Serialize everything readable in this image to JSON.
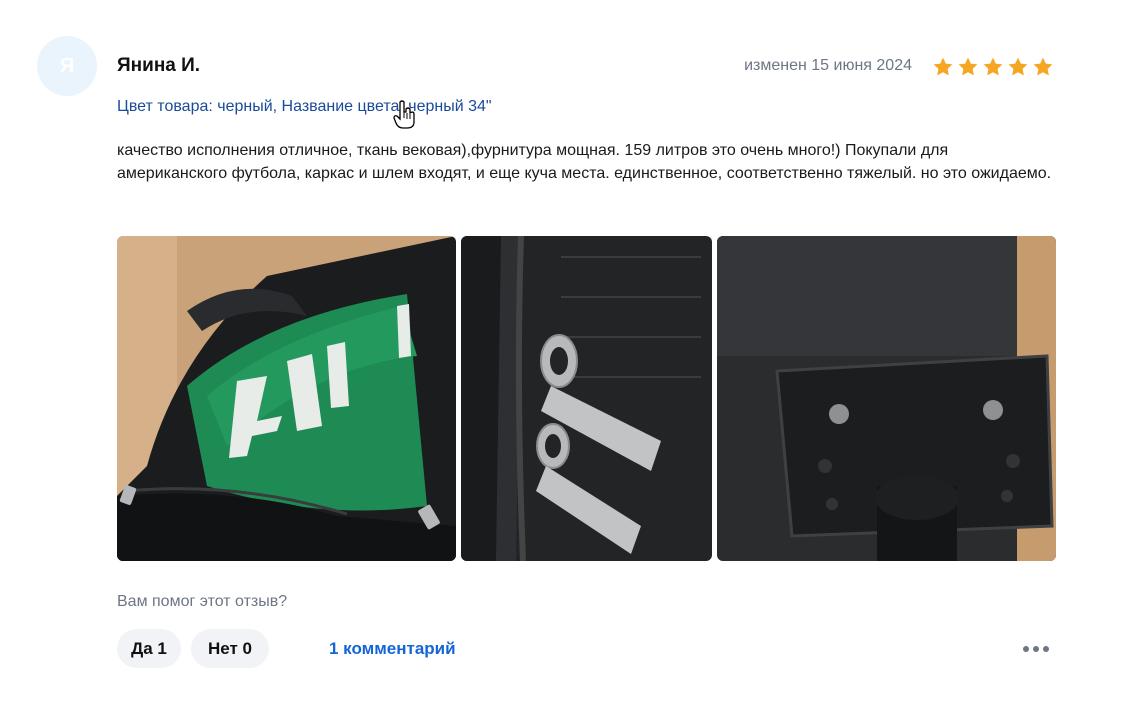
{
  "review": {
    "avatar_letter": "Я",
    "author": "Янина И.",
    "date": "изменен 15 июня 2024",
    "rating": 5,
    "star_color": "#f5a623",
    "variant": "Цвет товара: черный, Название цвета: черный 34\"",
    "text": "качество исполнения отличное, ткань вековая),фурнитура мощная. 159 литров это очень много!) Покупали для американского футбола, каркас и шлем входят, и еще куча места. единственное, соответственно тяжелый. но это ожидаемо.",
    "photos": [
      {
        "label": "bag-interior-photo"
      },
      {
        "label": "zipper-pulls-photo"
      },
      {
        "label": "wheel-housing-photo"
      }
    ]
  },
  "feedback": {
    "question": "Вам помог этот отзыв?",
    "yes_label": "Да 1",
    "no_label": "Нет 0",
    "comments_label": "1 комментарий"
  },
  "colors": {
    "link": "#1565d8",
    "variant": "#1a4a9b",
    "muted": "#6d7684",
    "avatar_bg": "#eaf4fc"
  }
}
